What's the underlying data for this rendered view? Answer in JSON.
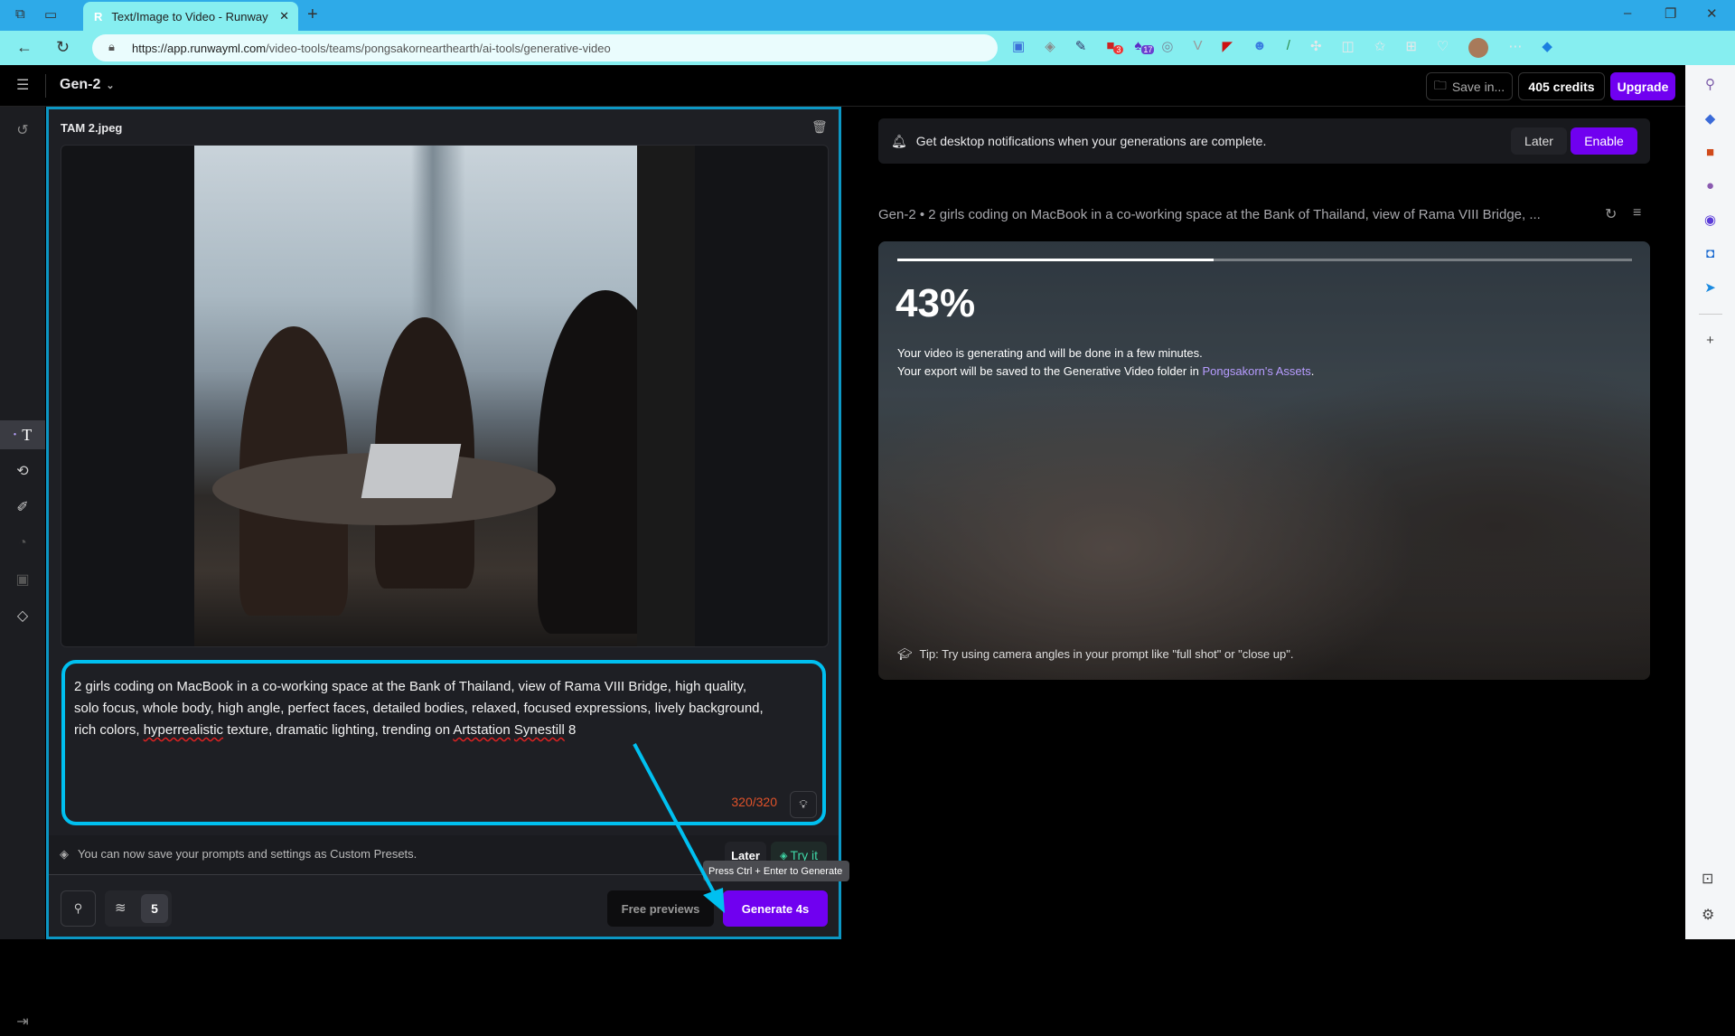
{
  "browser": {
    "tab_title": "Text/Image to Video - Runway",
    "url_host": "https://app.runwayml.com",
    "url_path": "/video-tools/teams/pongsakornearthearth/ai-tools/generative-video",
    "extension_badges": [
      "3",
      "17"
    ]
  },
  "header": {
    "model": "Gen-2",
    "save_label": "Save in...",
    "credits": "405 credits",
    "upgrade": "Upgrade"
  },
  "left": {
    "filename": "TAM 2.jpeg",
    "prompt_lines": [
      "2 girls coding on MacBook in a co-working space at the Bank of Thailand, view of Rama VIII Bridge, high quality,",
      "solo focus, whole body, high angle, perfect faces, detailed bodies, relaxed, focused expressions, lively background,"
    ],
    "prompt_l3_a": "rich colors, ",
    "prompt_l3_err1": "hyperrealistic",
    "prompt_l3_b": " texture, dramatic lighting, trending on ",
    "prompt_l3_err2": "Artstation",
    "prompt_l3_c": " ",
    "prompt_l3_err3": "Synestill",
    "prompt_l3_d": " 8",
    "char_count": "320/320",
    "presets_msg": "You can now save your prompts and settings as Custom Presets.",
    "later": "Later",
    "try_it": "Try it",
    "tooltip": "Press Ctrl + Enter to Generate",
    "motion_value": "5",
    "free_previews": "Free previews",
    "generate": "Generate 4s"
  },
  "right": {
    "notification": "Get desktop notifications when your generations are complete.",
    "notif_later": "Later",
    "notif_enable": "Enable",
    "generation_title": "Gen-2 • 2 girls coding on MacBook in a co-working space at the Bank of Thailand, view of Rama VIII Bridge, ...",
    "progress_percent": 43,
    "progress_label": "43%",
    "status_line1": "Your video is generating and will be done in a few minutes.",
    "status_line2": "Your export will be saved to the Generative Video folder in ",
    "assets_link": "Pongsakorn's Assets",
    "status_period": ".",
    "tip": "Tip: Try using camera angles in your prompt like \"full shot\" or \"close up\"."
  },
  "colors": {
    "accent": "#7000f0",
    "highlight": "#00c0f0",
    "count_warning": "#e0522a",
    "link": "#b79cff"
  }
}
